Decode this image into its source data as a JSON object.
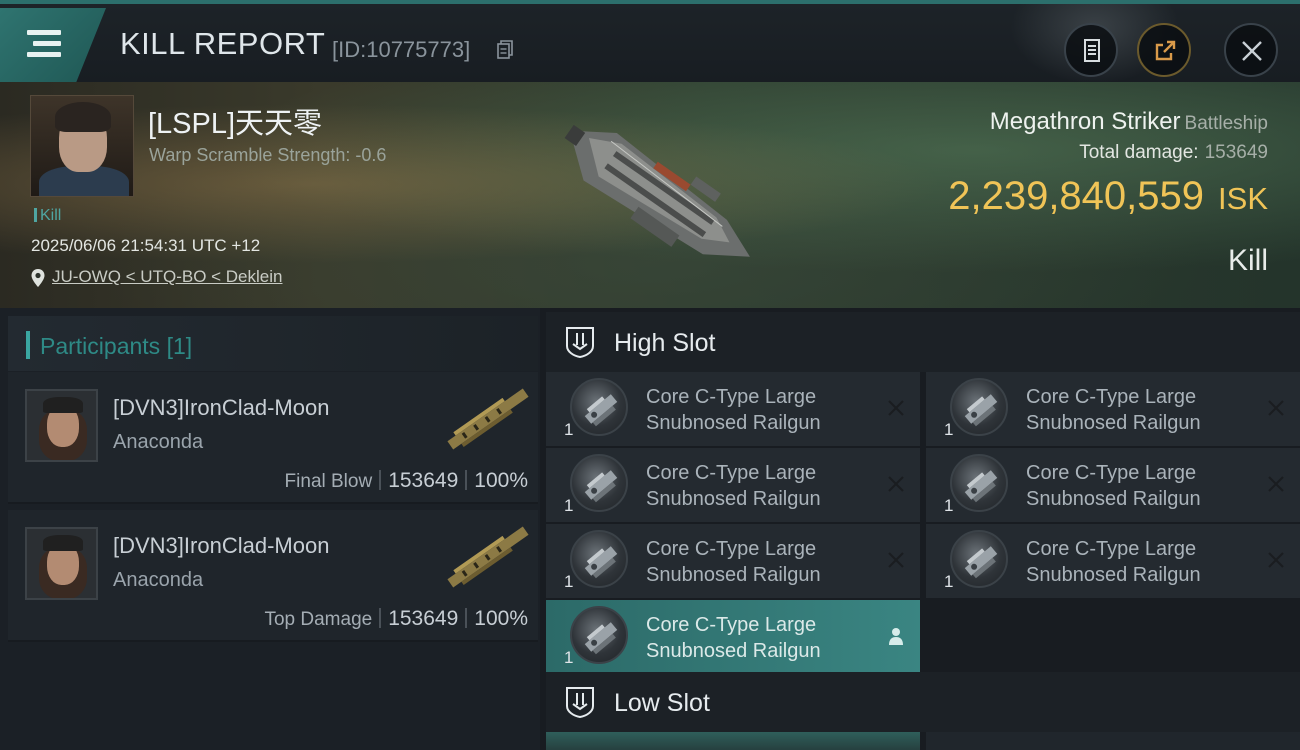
{
  "header": {
    "title": "KILL REPORT",
    "report_id": "[ID:10775773]"
  },
  "victim": {
    "name": "[LSPL]天天零",
    "warp_scramble": "Warp Scramble Strength: -0.6",
    "tag": "Kill",
    "timestamp": "2025/06/06 21:54:31 UTC +12",
    "location": "JU-OWQ < UTQ-BO < Deklein",
    "ship": "Megathron Striker",
    "ship_class": "Battleship",
    "total_damage_label": "Total damage:",
    "total_damage": "153649",
    "isk_value": "2,239,840,559",
    "isk_unit": "ISK",
    "result": "Kill"
  },
  "participants": {
    "title": "Participants",
    "count": "[1]",
    "list": [
      {
        "name": "[DVN3]IronClad-Moon",
        "ship": "Anaconda",
        "role": "Final Blow",
        "damage": "153649",
        "percent": "100%"
      },
      {
        "name": "[DVN3]IronClad-Moon",
        "ship": "Anaconda",
        "role": "Top Damage",
        "damage": "153649",
        "percent": "100%"
      }
    ]
  },
  "slots": {
    "high_label": "High Slot",
    "low_label": "Low Slot",
    "high": [
      {
        "qty": "1",
        "line1": "Core C-Type Large",
        "line2": "Snubnosed Railgun",
        "state": "destroyed"
      },
      {
        "qty": "1",
        "line1": "Core C-Type Large",
        "line2": "Snubnosed Railgun",
        "state": "destroyed"
      },
      {
        "qty": "1",
        "line1": "Core C-Type Large",
        "line2": "Snubnosed Railgun",
        "state": "destroyed"
      },
      {
        "qty": "1",
        "line1": "Core C-Type Large",
        "line2": "Snubnosed Railgun",
        "state": "dropped"
      },
      {
        "qty": "1",
        "line1": "Core C-Type Large",
        "line2": "Snubnosed Railgun",
        "state": "destroyed"
      },
      {
        "qty": "1",
        "line1": "Core C-Type Large",
        "line2": "Snubnosed Railgun",
        "state": "destroyed"
      },
      {
        "qty": "1",
        "line1": "Core C-Type Large",
        "line2": "Snubnosed Railgun",
        "state": "destroyed"
      }
    ]
  },
  "colors": {
    "accent_teal": "#3aa6a1",
    "isk_gold": "#f0c457"
  }
}
